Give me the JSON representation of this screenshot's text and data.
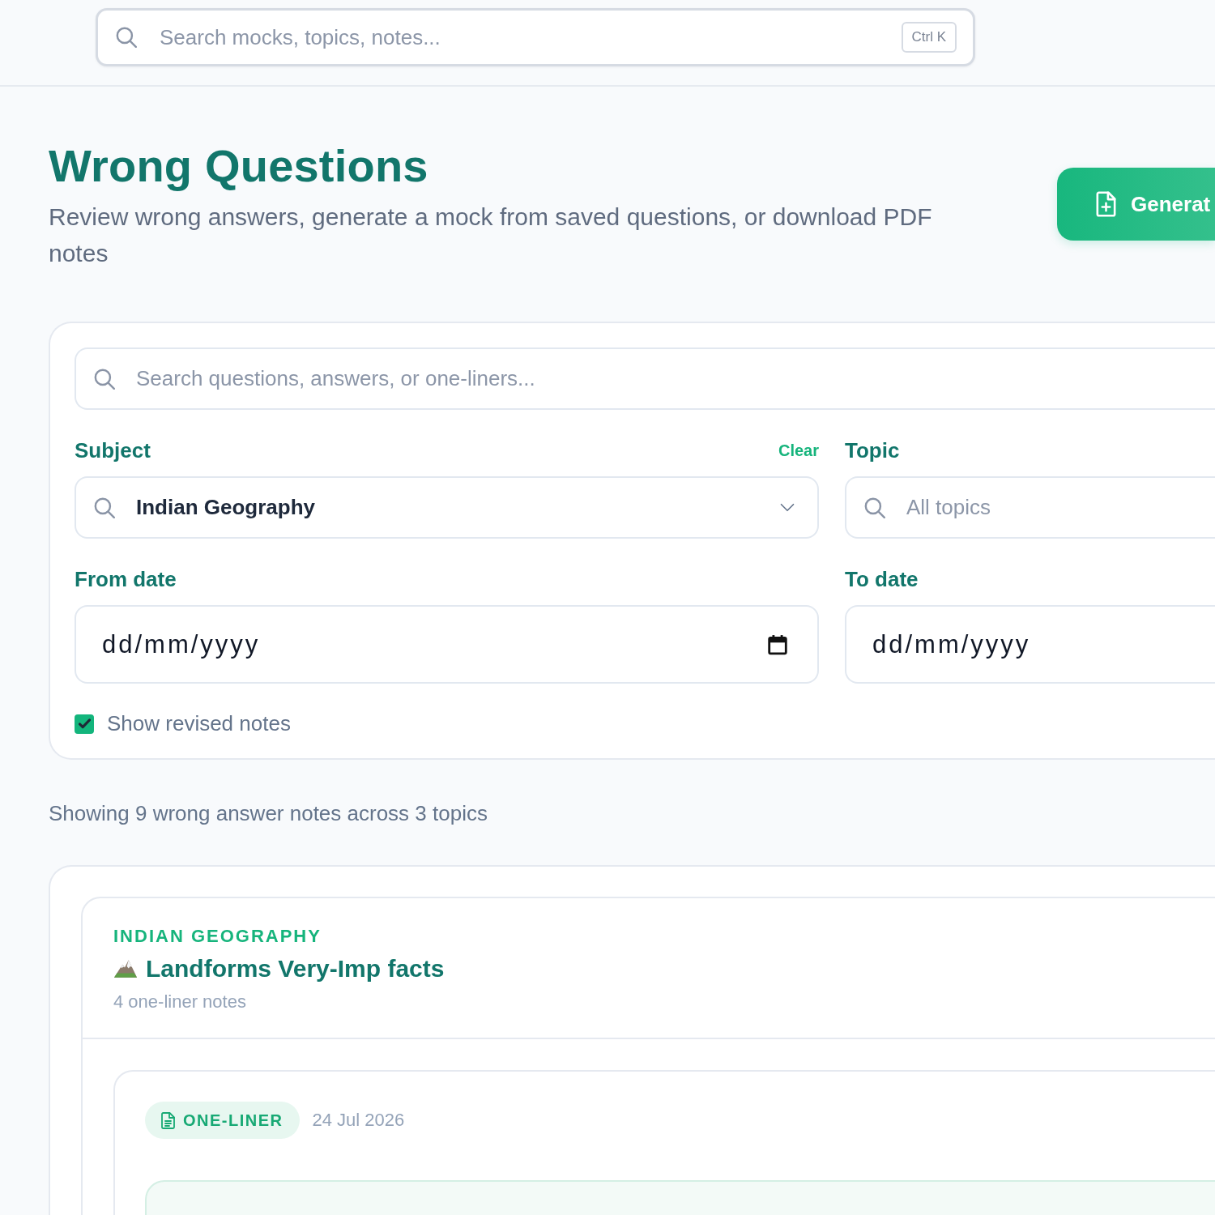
{
  "header": {
    "search": {
      "placeholder": "Search mocks, topics, notes...",
      "shortcut": "Ctrl K"
    }
  },
  "page": {
    "title": "Wrong Questions",
    "subtitle": "Review wrong answers, generate a mock from saved questions, or download PDF notes",
    "primary_button": {
      "label": "Generat"
    }
  },
  "filters": {
    "search": {
      "placeholder": "Search questions, answers, or one-liners..."
    },
    "subject": {
      "label": "Subject",
      "clear": "Clear",
      "value": "Indian Geography"
    },
    "topic": {
      "label": "Topic",
      "placeholder": "All topics"
    },
    "from_date": {
      "label": "From date",
      "placeholder": "dd/mm/yyyy"
    },
    "to_date": {
      "label": "To date",
      "placeholder": "dd/mm/yyyy"
    },
    "show_revised": {
      "label": "Show revised notes",
      "checked": true
    }
  },
  "summary": "Showing 9 wrong answer notes across 3 topics",
  "groups": [
    {
      "category": "INDIAN GEOGRAPHY",
      "title": "Landforms Very-Imp facts",
      "count": "4 one-liner notes",
      "notes": [
        {
          "type": "ONE-LINER",
          "date": "24 Jul 2026"
        }
      ]
    }
  ]
}
